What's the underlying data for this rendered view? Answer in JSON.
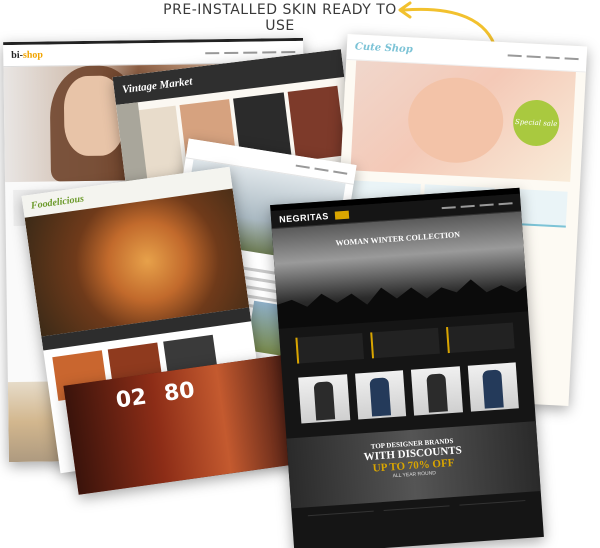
{
  "headline": "PRE-INSTALLED SKIN READY TO USE",
  "skins": {
    "bishop": {
      "logo_main": "bi-",
      "logo_accent": "shop"
    },
    "vintage": {
      "logo": "Vintage Market"
    },
    "cute": {
      "logo": "Cute Shop",
      "badge": "Special sale"
    },
    "food": {
      "logo": "Foodelicious"
    },
    "countdown": {
      "days": "02",
      "hours": "80"
    },
    "negritas": {
      "logo": "NEGRITAS",
      "hero_title": "WOMAN WINTER COLLECTION",
      "banner_line1": "TOP DESIGNER BRANDS",
      "banner_line2": "WITH DISCOUNTS",
      "banner_line3": "UP TO 70% OFF",
      "banner_line4": "ALL YEAR ROUND"
    }
  },
  "colors": {
    "accent_gold": "#d9a500",
    "bishop_accent": "#f1a400",
    "cute_blue": "#7cc3d6",
    "cute_badge": "#a9c93f",
    "food_green": "#6b9a2a",
    "arrow": "#f2c12e"
  },
  "icons": [
    "curved-arrow-icon"
  ]
}
